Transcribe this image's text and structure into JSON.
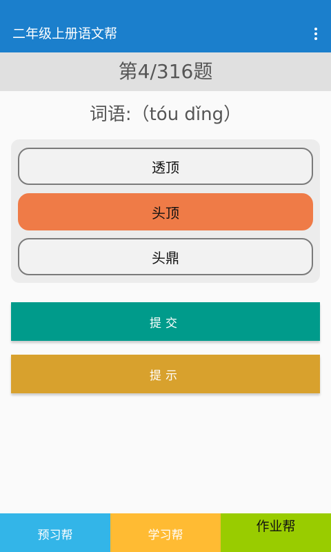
{
  "app": {
    "title": "二年级上册语文帮"
  },
  "icons": {
    "menu": "more-vertical-icon"
  },
  "colors": {
    "appbar": "#1b7fcc",
    "selected_option": "#ef7b47",
    "submit": "#009b8b",
    "hint": "#d8a12d",
    "nav_preview": "#33b5e8",
    "nav_study": "#ffbb33",
    "nav_homework": "#99cc00"
  },
  "quiz": {
    "progress": "第4/316题",
    "question": "词语:（tóu dǐng）",
    "options": [
      {
        "label": "透顶",
        "selected": false
      },
      {
        "label": "头顶",
        "selected": true
      },
      {
        "label": "头鼎",
        "selected": false
      }
    ]
  },
  "actions": {
    "submit_label": "提交",
    "hint_label": "提示"
  },
  "bottom_nav": {
    "items": [
      {
        "label": "预习帮",
        "active": false
      },
      {
        "label": "学习帮",
        "active": false
      },
      {
        "label": "作业帮",
        "active": true
      }
    ]
  }
}
